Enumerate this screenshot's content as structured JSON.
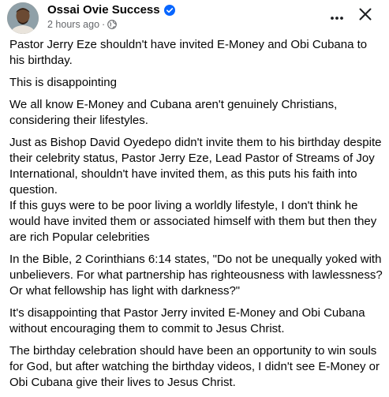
{
  "post": {
    "author": "Ossai Ovie Success",
    "time": "2 hours ago",
    "separator": "·",
    "paragraphs": [
      "Pastor Jerry Eze shouldn't have invited E-Money and Obi Cubana to his birthday.",
      "This is disappointing",
      "We all know E-Money and Cubana aren't genuinely Christians, considering their lifestyles.",
      "Just as Bishop David Oyedepo didn't invite them to his birthday despite their celebrity status, Pastor Jerry Eze, Lead Pastor of Streams of Joy International, shouldn't have invited them, as this puts his faith into question.",
      "If this guys were to be poor living a worldly lifestyle, I don't think he would have invited them or associated himself with them but then they are rich Popular celebrities",
      "In the Bible, 2 Corinthians 6:14 states, \"Do not be unequally yoked with unbelievers. For what partnership has righteousness with lawlessness? Or what fellowship has light with darkness?\"",
      "It's disappointing that Pastor Jerry invited E-Money and Obi Cubana without encouraging them to commit to Jesus Christ.",
      "The birthday celebration should have been an opportunity to win souls for God, but after watching the birthday videos, I didn't see E-Money or Obi Cubana give their lives to Jesus Christ."
    ]
  },
  "icons": {
    "verified": "verified-badge-icon",
    "globe": "globe-icon",
    "more": "more-options-icon",
    "close": "close-icon"
  },
  "colors": {
    "text": "#050505",
    "secondary": "#65676b",
    "verified_blue": "#0866ff",
    "icon": "#1c1e21"
  }
}
